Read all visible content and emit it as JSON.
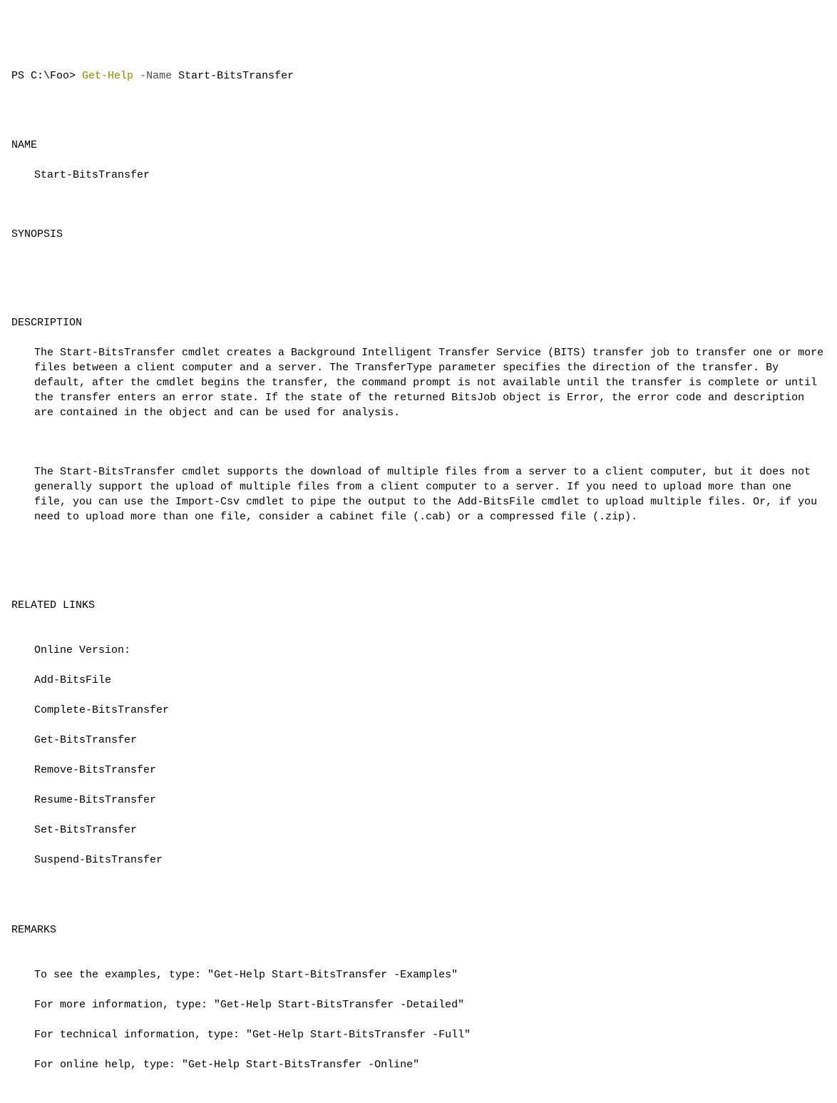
{
  "prompt": {
    "ps": "PS ",
    "path": "C:\\Foo> ",
    "cmdlet": "Get-Help",
    "param_flag": " -",
    "param_name": "Name",
    "argument": " Start-BitsTransfer"
  },
  "sections": {
    "name_heading": "NAME",
    "name_value": "Start-BitsTransfer",
    "synopsis_heading": "SYNOPSIS",
    "description_heading": "DESCRIPTION",
    "description_p1": "The Start-BitsTransfer cmdlet creates a Background Intelligent Transfer Service (BITS) transfer job to transfer one or more files between a client computer and a server. The TransferType parameter specifies the direction of the transfer. By default, after the cmdlet begins the transfer, the command prompt is not available until the transfer is complete or until the transfer enters an error state. If the state of the returned BitsJob object is Error, the error code and description are contained in the object and can be used for analysis.",
    "description_p2": "The Start-BitsTransfer cmdlet supports the download of multiple files from a server to a client computer, but it does not generally support the upload of multiple files from a client computer to a server. If you need to upload more than one file, you can use the Import-Csv cmdlet to pipe the output to the Add-BitsFile cmdlet to upload multiple files. Or, if you need to upload more than one file, consider a cabinet file (.cab) or a compressed file (.zip).",
    "related_heading": "RELATED LINKS",
    "links": [
      "Online Version:",
      "Add-BitsFile",
      "Complete-BitsTransfer",
      "Get-BitsTransfer",
      "Remove-BitsTransfer",
      "Resume-BitsTransfer",
      "Set-BitsTransfer",
      "Suspend-BitsTransfer"
    ],
    "remarks_heading": "REMARKS",
    "remarks": [
      "To see the examples, type: \"Get-Help Start-BitsTransfer -Examples\"",
      "For more information, type: \"Get-Help Start-BitsTransfer -Detailed\"",
      "For technical information, type: \"Get-Help Start-BitsTransfer -Full\"",
      "For online help, type: \"Get-Help Start-BitsTransfer -Online\""
    ]
  }
}
